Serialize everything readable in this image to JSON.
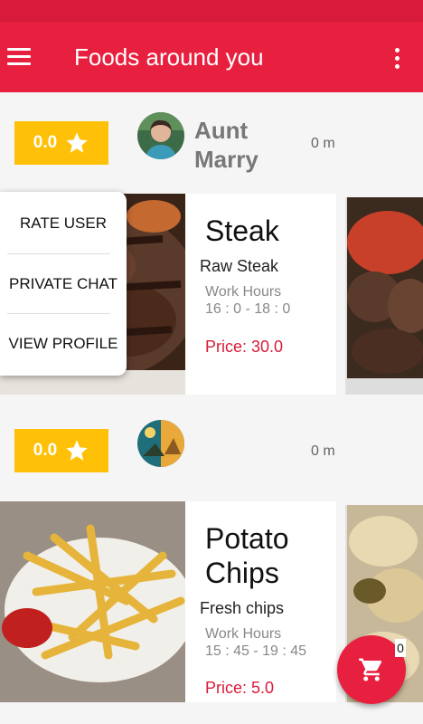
{
  "appbar": {
    "title": "Foods around you"
  },
  "posts": [
    {
      "rating": "0.0",
      "username": "Aunt Marry",
      "distance": "0 m",
      "food": {
        "name": "Steak",
        "description": "Raw Steak",
        "work_hours_label": "Work Hours",
        "work_hours": "16 : 0 - 18 : 0",
        "price": "Price: 30.0"
      }
    },
    {
      "rating": "0.0",
      "username": "",
      "distance": "0 m",
      "food": {
        "name": "Potato Chips",
        "description": "Fresh chips",
        "work_hours_label": "Work Hours",
        "work_hours": "15 : 45 - 19 : 45",
        "price": "Price: 5.0"
      }
    }
  ],
  "popup_menu": {
    "rate_user": "RATE USER",
    "private_chat": "PRIVATE CHAT",
    "view_profile": "VIEW PROFILE"
  },
  "cart": {
    "badge": "0"
  },
  "colors": {
    "primary": "#e8203f",
    "rating": "#ffc107",
    "price": "#d81b3a"
  },
  "icons": [
    "menu-icon",
    "more-vert-icon",
    "star-icon",
    "cart-icon"
  ]
}
